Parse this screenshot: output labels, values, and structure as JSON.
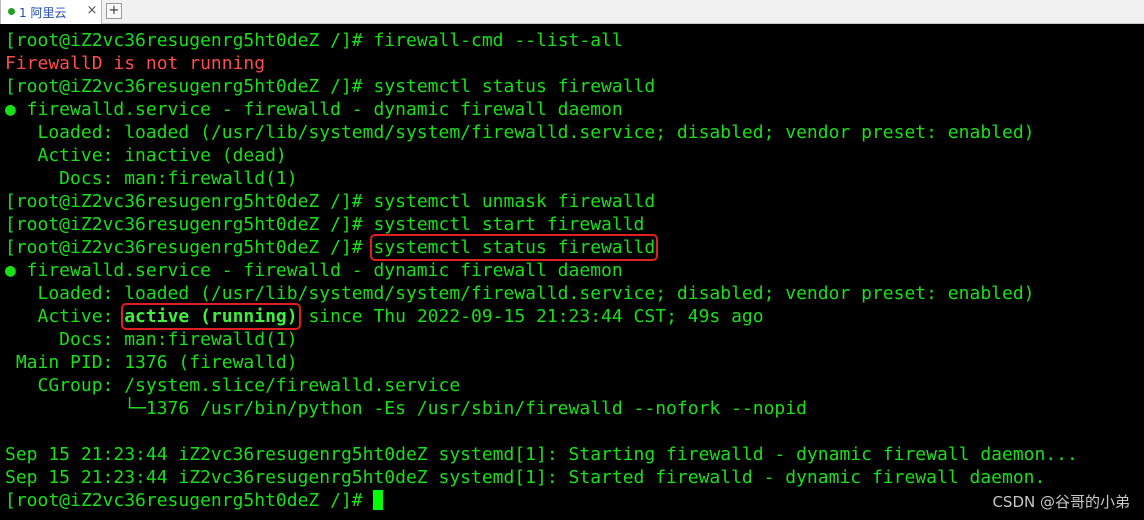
{
  "tabbar": {
    "tab_label": "1 阿里云",
    "close_glyph": "×",
    "new_tab_glyph": "+"
  },
  "terminal": {
    "prompt": "[root@iZ2vc36resugenrg5ht0deZ /]# ",
    "lines": [
      {
        "cmd": "firewall-cmd --list-all"
      },
      {
        "text": "FirewallD is not running"
      },
      {
        "cmd": "systemctl status firewalld"
      },
      {
        "text": "● firewalld.service - firewalld - dynamic firewall daemon"
      },
      {
        "text": "   Loaded: loaded (/usr/lib/systemd/system/firewalld.service; disabled; vendor preset: enabled)"
      },
      {
        "text": "   Active: inactive (dead)"
      },
      {
        "text": "     Docs: man:firewalld(1)"
      },
      {
        "cmd": "systemctl unmask firewalld"
      },
      {
        "cmd": "systemctl start firewalld"
      },
      {
        "cmd": "systemctl status firewalld"
      },
      {
        "text": "● firewalld.service - firewalld - dynamic firewall daemon"
      },
      {
        "text": "   Loaded: loaded (/usr/lib/systemd/system/firewalld.service; disabled; vendor preset: enabled)"
      },
      {
        "prefix": "   Active: ",
        "status": "active (running)",
        "suffix": " since Thu 2022-09-15 21:23:44 CST; 49s ago"
      },
      {
        "text": "     Docs: man:firewalld(1)"
      },
      {
        "text": " Main PID: 1376 (firewalld)"
      },
      {
        "text": "   CGroup: /system.slice/firewalld.service"
      },
      {
        "text": "           └─1376 /usr/bin/python -Es /usr/sbin/firewalld --nofork --nopid"
      },
      {
        "text": ""
      },
      {
        "text": "Sep 15 21:23:44 iZ2vc36resugenrg5ht0deZ systemd[1]: Starting firewalld - dynamic firewall daemon..."
      },
      {
        "text": "Sep 15 21:23:44 iZ2vc36resugenrg5ht0deZ systemd[1]: Started firewalld - dynamic firewall daemon."
      }
    ]
  },
  "watermark": "CSDN @谷哥的小弟",
  "colors": {
    "background": "#000000",
    "text": "#17e017",
    "error": "#ff4c4c",
    "highlight_box": "#e02020",
    "cursor": "#00ff00"
  }
}
